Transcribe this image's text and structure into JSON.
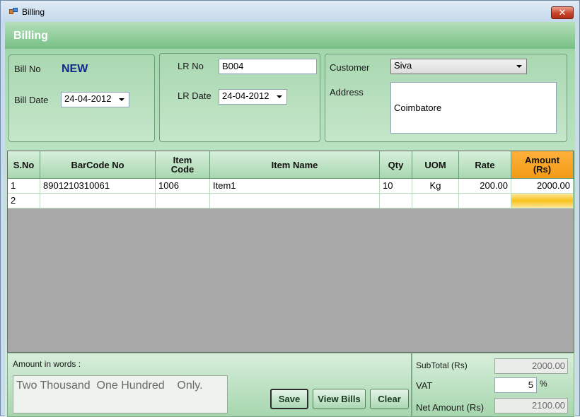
{
  "window": {
    "title": "Billing",
    "close_label": "✕"
  },
  "header": {
    "title": "Billing"
  },
  "bill": {
    "no_label": "Bill No",
    "no_value": "NEW",
    "date_label": "Bill Date",
    "date_value": "24-04-2012"
  },
  "lr": {
    "no_label": "LR No",
    "no_value": "B004",
    "date_label": "LR Date",
    "date_value": "24-04-2012"
  },
  "customer": {
    "label": "Customer",
    "value": "Siva",
    "address_label": "Address",
    "address_value": "Coimbatore"
  },
  "grid": {
    "columns": [
      "S.No",
      "BarCode No",
      "Item\nCode",
      "Item Name",
      "Qty",
      "UOM",
      "Rate",
      "Amount\n(Rs)"
    ],
    "rows": [
      [
        "1",
        "8901210310061",
        "1006",
        "Item1",
        "10",
        "Kg",
        "200.00",
        "2000.00"
      ],
      [
        "2",
        "",
        "",
        "",
        "",
        "",
        "",
        ""
      ]
    ]
  },
  "footer": {
    "words_label": "Amount in words :",
    "words_value": "Two Thousand  One Hundred    Only.",
    "save_label": "Save",
    "view_bills_label": "View Bills",
    "clear_label": "Clear",
    "subtotal_label": "SubTotal (Rs)",
    "subtotal_value": "2000.00",
    "vat_label": "VAT",
    "vat_value": "5",
    "vat_unit": "%",
    "net_label": "Net Amount (Rs)",
    "net_value": "2100.00"
  },
  "colors": {
    "accent_header": "#f29a14",
    "bill_no": "#0d2a8a",
    "panel_green": "#a9d8b1"
  }
}
